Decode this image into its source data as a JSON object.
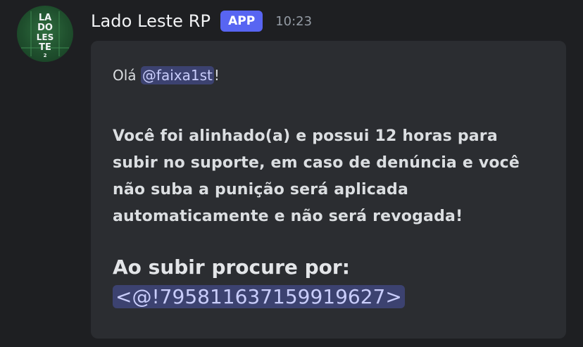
{
  "message": {
    "author": {
      "name": "Lado Leste RP",
      "badge": "APP",
      "avatar_text": [
        "LA",
        "DO",
        "LES",
        "TE",
        "2"
      ]
    },
    "timestamp": "10:23",
    "embed": {
      "greeting_prefix": "Olá ",
      "greeting_mention": "@faixa1st",
      "greeting_suffix": "!",
      "body": "Você foi alinhado(a) e possui 12 horas para subir no suporte, em caso de denúncia e você não suba a punição será aplicada automaticamente e não será revogada!",
      "procure_label": "Ao subir procure por: ",
      "procure_mention": "<@!795811637159919627>"
    },
    "colors": {
      "background": "#1e1f22",
      "embed_background": "#2b2d31",
      "badge": "#5865f2",
      "mention_background": "#3c4270",
      "mention_text": "#c9cdfb"
    }
  }
}
